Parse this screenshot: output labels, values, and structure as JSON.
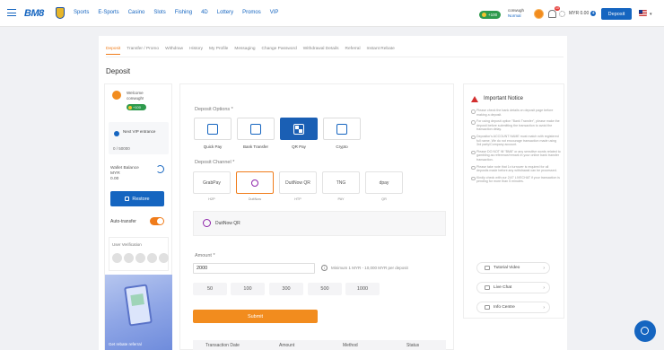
{
  "header": {
    "datetime": "04/09/2025 04:49:37 (GMT+8)",
    "logo": "BM8",
    "nav": [
      "Sports",
      "E-Sports",
      "Casino",
      "Slots",
      "Fishing",
      "4D",
      "Lottery",
      "Promos",
      "VIP"
    ],
    "balance_badge": "+100",
    "user_name": "conwugh",
    "user_tier": "Normal",
    "notification_count": "10",
    "wallet_label": "MYR 0.00",
    "deposit_button": "Deposit"
  },
  "tabs": [
    "Deposit",
    "Transfer / Promo",
    "Withdraw",
    "History",
    "My Profile",
    "Messaging",
    "Change Password",
    "Withdrawal Details",
    "Referral",
    "Instant Rebate"
  ],
  "page_title": "Deposit",
  "left_panel": {
    "welcome": "Welcome",
    "username": "conwugh!",
    "badge": "+100",
    "next_vip_label": "Next VIP entrance",
    "progress": "0 / 50000",
    "wallet_balance_label": "Wallet Balance",
    "currency": "MYR",
    "amount": "0.00",
    "restore_button": "Restore",
    "auto_transfer_label": "Auto-transfer",
    "auto_transfer_on": true,
    "verification_label": "User Verification",
    "banner_text": "Get rebate referral"
  },
  "form": {
    "deposit_options_label": "Deposit Options *",
    "options": [
      {
        "label": "Quick Pay",
        "icon": "quick-pay-icon"
      },
      {
        "label": "Bank Transfer",
        "icon": "bank-icon"
      },
      {
        "label": "QR Pay",
        "icon": "qr-icon",
        "selected": true
      },
      {
        "label": "Crypto",
        "icon": "crypto-icon"
      }
    ],
    "channel_label": "Deposit Channel *",
    "channels": [
      {
        "name": "GrabPay",
        "caption": "H2P"
      },
      {
        "name": "DuitNow",
        "caption": "DuitNow",
        "selected": true
      },
      {
        "name": "DuitNow QR",
        "caption": "HTP"
      },
      {
        "name": "TNG",
        "caption": "PAY"
      },
      {
        "name": "dpay",
        "caption": "QR"
      }
    ],
    "selected_channel": "DuitNow QR",
    "amount_label": "Amount *",
    "amount_value": "2000",
    "amount_info": "Minimum 1 MYR - 10,000 MYR per deposit",
    "chips": [
      "50",
      "100",
      "300",
      "500",
      "1000"
    ],
    "submit_button": "Submit",
    "table_headers": [
      "Transaction Date",
      "Amount",
      "Method",
      "Status"
    ]
  },
  "notice": {
    "title": "Important Notice",
    "notes": [
      "Please check the bank details on deposit page before making a deposit.",
      "For using deposit option \"Bank Transfer\", please make the deposit before submitting the transaction to avoid the transaction delay.",
      "Depositor's ACCOUNT NAME must match with registered full name. We do not encourage transaction made using 3rd party/Company account.",
      "Please DO NOT fill \"BM8\" or any sensitive words related to gambling as reference/remark in your online bank transfer transaction.",
      "Please take note that 1x turnover is required for all deposits made before any withdrawal can be processed.",
      "Kindly check with our 24/7 LIVECHAT if your transaction is pending for more than 5 minutes."
    ],
    "links": [
      "Tutorial Video",
      "Live Chat",
      "Info Centre"
    ]
  }
}
